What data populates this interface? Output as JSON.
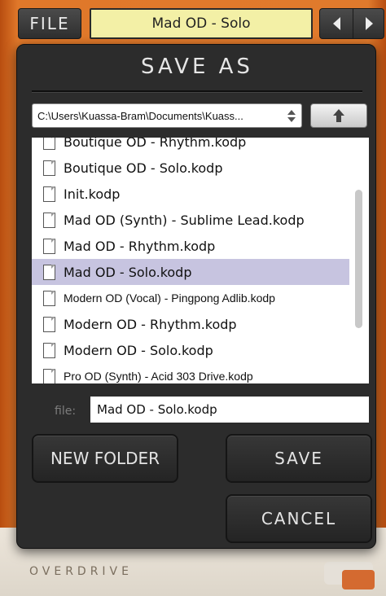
{
  "toolbar": {
    "file_label": "FILE",
    "preset_name": "Mad OD - Solo"
  },
  "dialog": {
    "title": "SAVE AS",
    "path": "C:\\Users\\Kuassa-Bram\\Documents\\Kuass...",
    "files": [
      {
        "name": "Boutique OD - Rhythm.kodp",
        "selected": false
      },
      {
        "name": "Boutique OD - Solo.kodp",
        "selected": false
      },
      {
        "name": "Init.kodp",
        "selected": false
      },
      {
        "name": "Mad OD (Synth) - Sublime Lead.kodp",
        "selected": false
      },
      {
        "name": "Mad OD - Rhythm.kodp",
        "selected": false
      },
      {
        "name": "Mad OD - Solo.kodp",
        "selected": true
      },
      {
        "name": "Modern OD (Vocal) - Pingpong Adlib.kodp",
        "selected": false
      },
      {
        "name": "Modern OD - Rhythm.kodp",
        "selected": false
      },
      {
        "name": "Modern OD - Solo.kodp",
        "selected": false
      },
      {
        "name": "Pro OD (Synth) - Acid 303 Drive.kodp",
        "selected": false
      }
    ],
    "filename_label": "file:",
    "filename_value": "Mad OD - Solo.kodp",
    "new_folder_label": "NEW FOLDER",
    "save_label": "SAVE",
    "cancel_label": "CANCEL"
  },
  "background": {
    "brand_text": "OVERDRIVE"
  },
  "colors": {
    "preset_display_bg": "#f3f0a6",
    "selection": "#c7c4e0",
    "dialog_bg": "#2c2c2c"
  }
}
